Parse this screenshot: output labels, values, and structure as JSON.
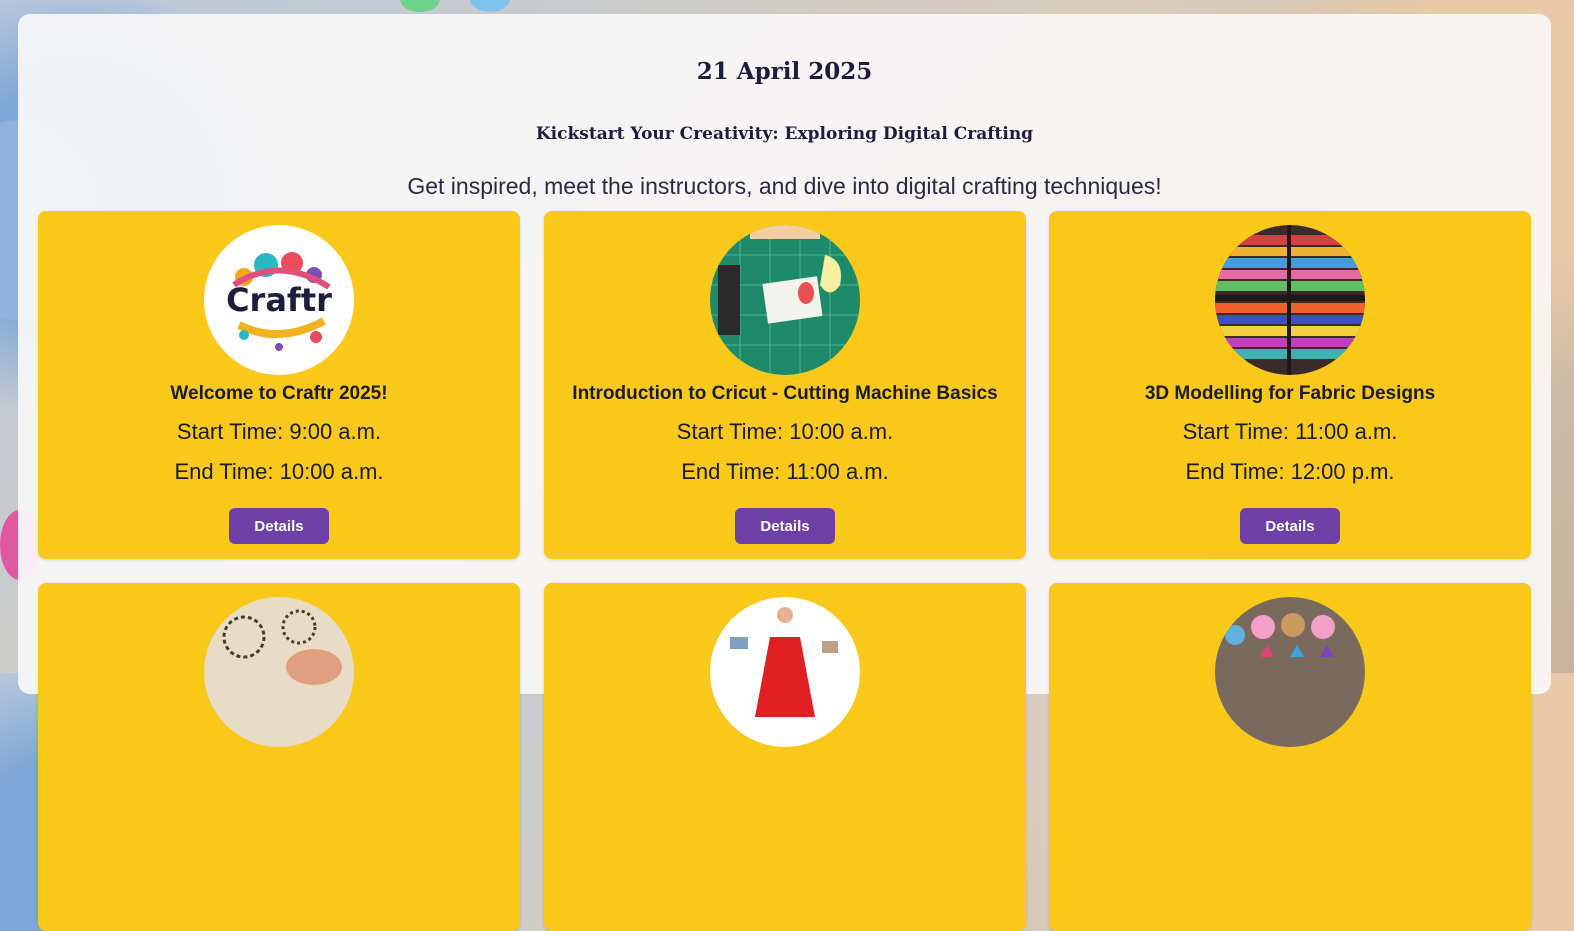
{
  "header": {
    "date": "21 April 2025",
    "subtitle": "Kickstart Your Creativity: Exploring Digital Crafting",
    "tagline": "Get inspired, meet the instructors, and dive into digital crafting techniques!"
  },
  "sessions": [
    {
      "title": "Welcome to Craftr 2025!",
      "start": "Start Time: 9:00 a.m.",
      "end": "End Time: 10:00 a.m.",
      "button": "Details",
      "image": "craftr-logo",
      "logo_text": "Craftr"
    },
    {
      "title": "Introduction to Cricut - Cutting Machine Basics",
      "start": "Start Time: 10:00 a.m.",
      "end": "End Time: 11:00 a.m.",
      "button": "Details",
      "image": "cutting-mat-photo"
    },
    {
      "title": "3D Modelling for Fabric Designs",
      "start": "Start Time: 11:00 a.m.",
      "end": "End Time: 12:00 p.m.",
      "button": "Details",
      "image": "fabric-rolls-photo"
    },
    {
      "image": "paper-snowflake-photo"
    },
    {
      "image": "red-dress-photo"
    },
    {
      "image": "party-stickers-photo"
    }
  ],
  "colors": {
    "card": "#f9c81a",
    "button": "#6e3fa6",
    "heading": "#1f1d3d"
  }
}
